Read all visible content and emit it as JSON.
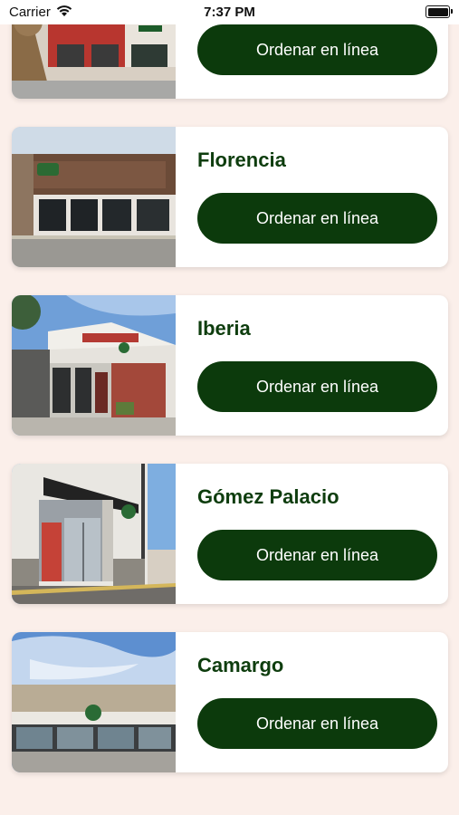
{
  "status": {
    "carrier": "Carrier",
    "time": "7:37 PM"
  },
  "locations": [
    {
      "name": "",
      "button": "Ordenar en línea",
      "photo": "storefront-red-facade"
    },
    {
      "name": "Florencia",
      "button": "Ordenar en línea",
      "photo": "storefront-brown-panels"
    },
    {
      "name": "Iberia",
      "button": "Ordenar en línea",
      "photo": "storefront-corner-building"
    },
    {
      "name": "Gómez Palacio",
      "button": "Ordenar en línea",
      "photo": "storefront-white-building"
    },
    {
      "name": "Camargo",
      "button": "Ordenar en línea",
      "photo": "storefront-mall-front"
    }
  ],
  "colors": {
    "accent": "#0c3a0c",
    "title": "#0e3d0e",
    "background": "#fbefea"
  }
}
